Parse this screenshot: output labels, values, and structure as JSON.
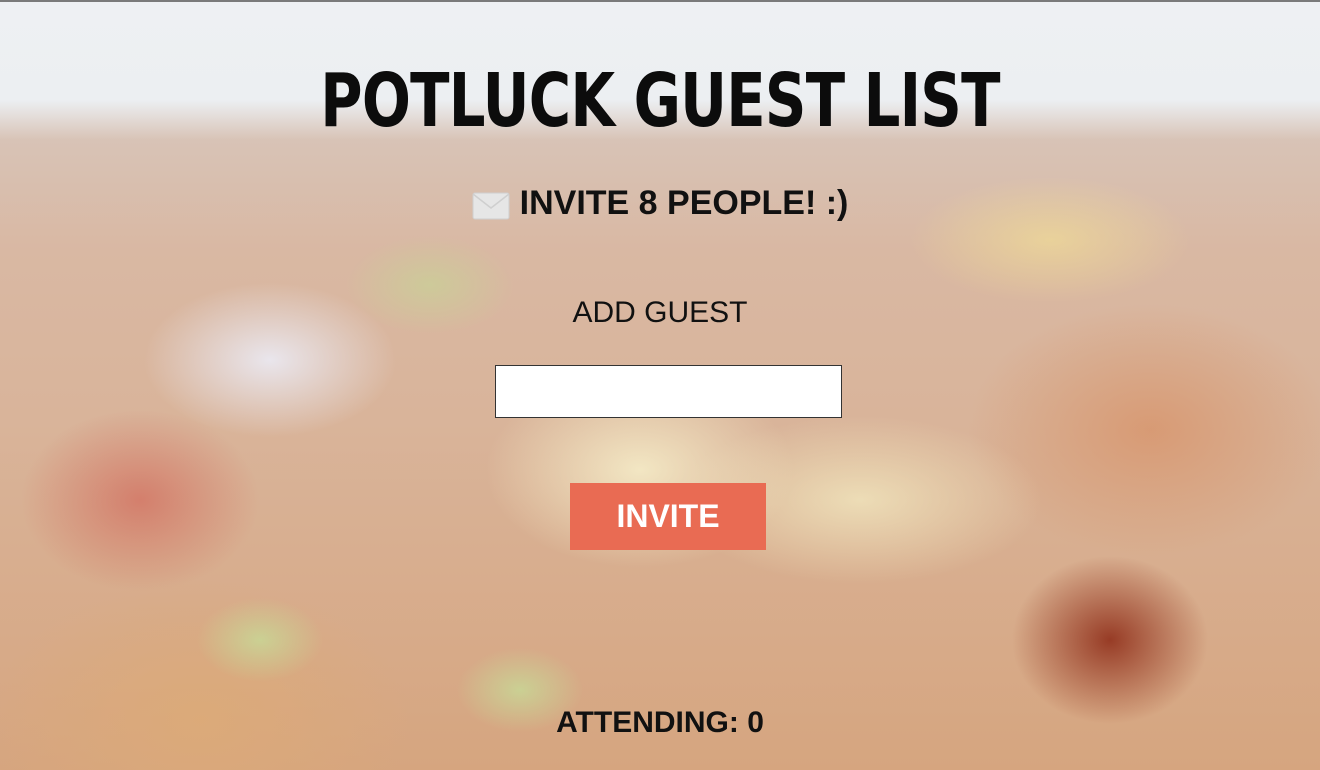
{
  "page": {
    "title": "POTLUCK GUEST LIST",
    "subtitle": "INVITE 8 PEOPLE! :)",
    "subtitle_icon": "envelope-icon"
  },
  "form": {
    "add_label": "ADD GUEST",
    "guest_input_value": "",
    "guest_input_placeholder": "",
    "invite_button_label": "INVITE"
  },
  "status": {
    "attending_label": "ATTENDING: 0",
    "attending_count": 0
  },
  "colors": {
    "accent": "#e96b53",
    "text": "#111111"
  }
}
